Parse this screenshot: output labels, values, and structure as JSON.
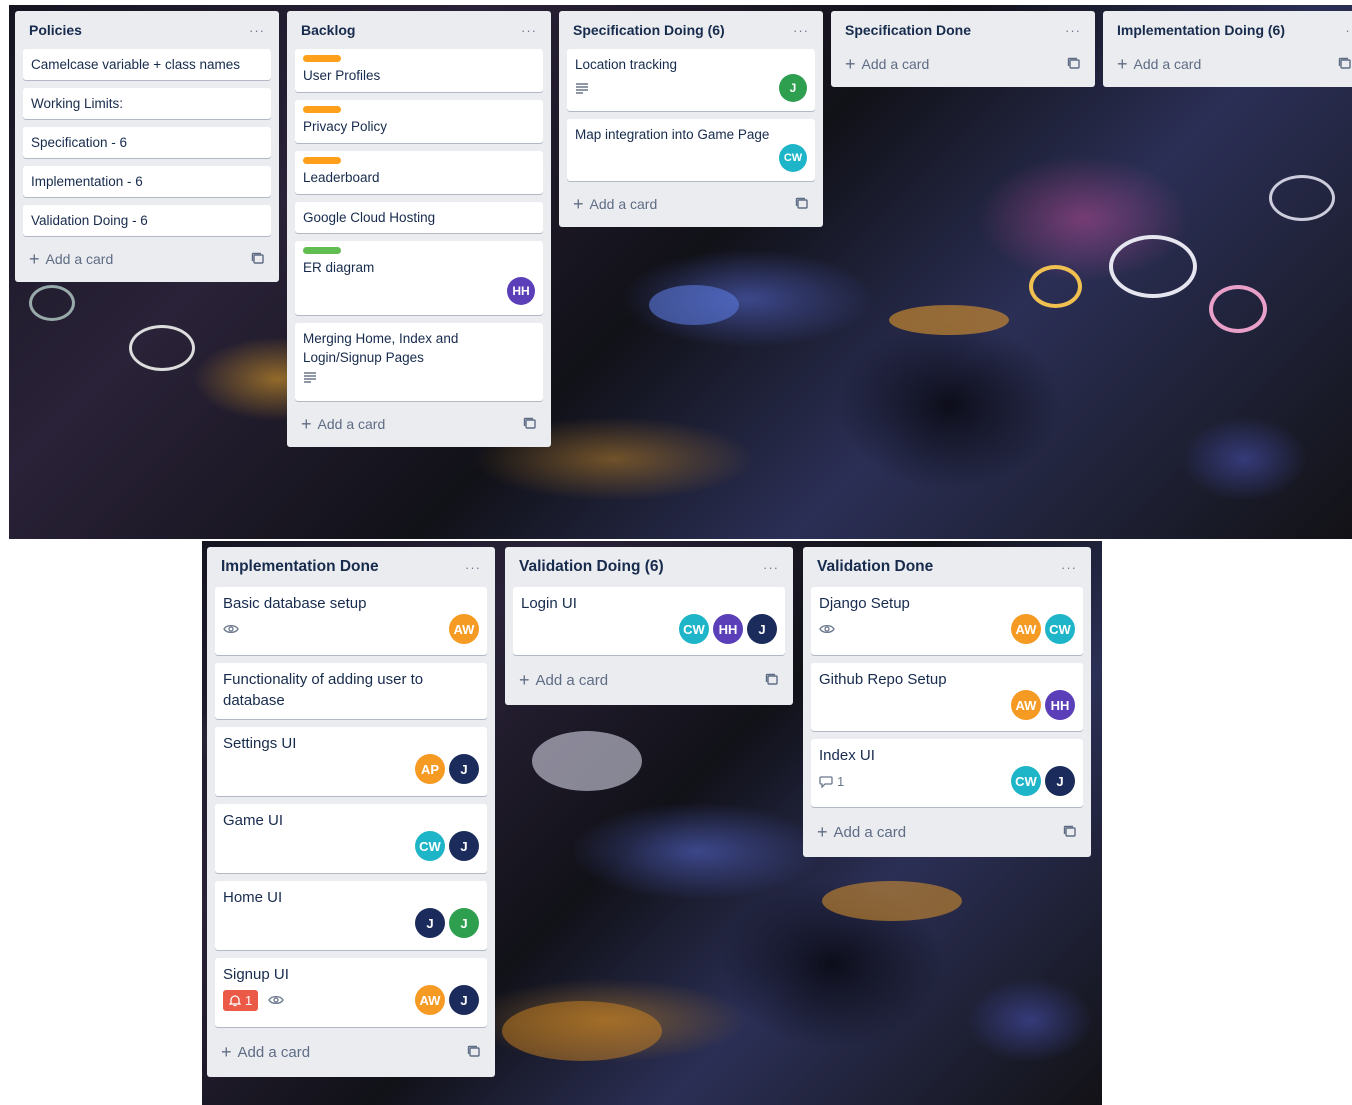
{
  "colors": {
    "list_bg": "#ebecf0",
    "label_orange": "#ff9f1a",
    "label_green": "#61bd4f",
    "avatar_green": "#2e9e4f",
    "avatar_teal": "#1fb5c9",
    "avatar_purple": "#5a3fb8",
    "avatar_orange": "#f59a23",
    "avatar_navy": "#1a2b5c",
    "notification_red": "#eb5a46"
  },
  "add_card_label": "Add a card",
  "top": {
    "policies": {
      "title": "Policies",
      "cards": [
        "Camelcase variable + class names",
        "Working Limits:",
        "Specification - 6",
        "Implementation - 6",
        "Validation Doing - 6"
      ]
    },
    "backlog": {
      "title": "Backlog",
      "cards": {
        "user_profiles": "User Profiles",
        "privacy_policy": "Privacy Policy",
        "leaderboard": "Leaderboard",
        "google_cloud": "Google Cloud Hosting",
        "er_diagram": "ER diagram",
        "er_member": "HH",
        "merging": "Merging Home, Index and Login/Signup Pages"
      }
    },
    "spec_doing": {
      "title": "Specification Doing (6)",
      "location": "Location tracking",
      "location_member": "J",
      "map": "Map integration into Game Page",
      "map_member": "CW"
    },
    "spec_done": {
      "title": "Specification Done"
    },
    "impl_doing": {
      "title": "Implementation Doing (6)"
    }
  },
  "bottom": {
    "impl_done": {
      "title": "Implementation Done",
      "basic_db": "Basic database setup",
      "basic_db_members": [
        "AW"
      ],
      "adding_user": "Functionality of adding user to database",
      "settings": "Settings UI",
      "settings_members": [
        "AP",
        "J"
      ],
      "game": "Game UI",
      "game_members": [
        "CW",
        "J"
      ],
      "home": "Home UI",
      "home_members": [
        "J",
        "J"
      ],
      "signup": "Signup UI",
      "signup_notifications": "1",
      "signup_members": [
        "AW",
        "J"
      ]
    },
    "val_doing": {
      "title": "Validation Doing (6)",
      "login": "Login UI",
      "login_members": [
        "CW",
        "HH",
        "J"
      ]
    },
    "val_done": {
      "title": "Validation Done",
      "django": "Django Setup",
      "django_members": [
        "AW",
        "CW"
      ],
      "github": "Github Repo Setup",
      "github_members": [
        "AW",
        "HH"
      ],
      "index": "Index UI",
      "index_comments": "1",
      "index_members": [
        "CW",
        "J"
      ]
    }
  }
}
